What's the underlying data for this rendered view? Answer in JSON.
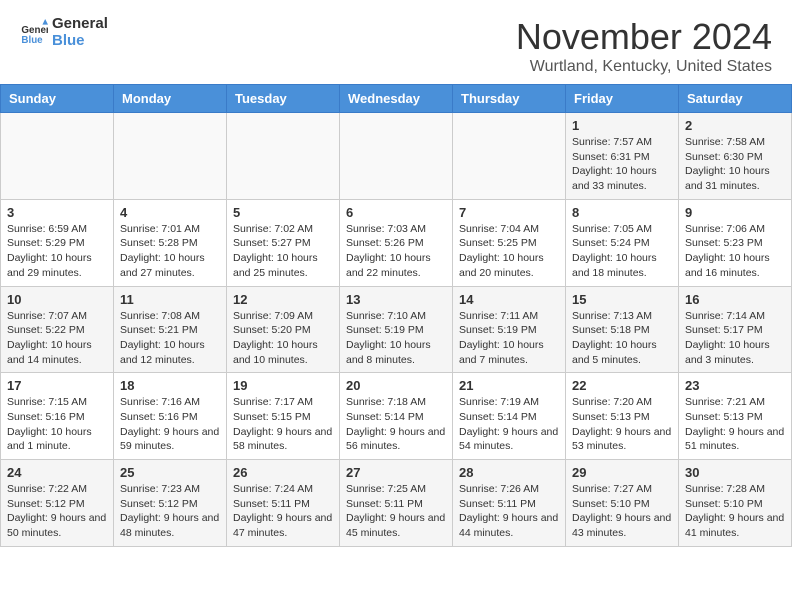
{
  "header": {
    "logo_line1": "General",
    "logo_line2": "Blue",
    "month": "November 2024",
    "location": "Wurtland, Kentucky, United States"
  },
  "weekdays": [
    "Sunday",
    "Monday",
    "Tuesday",
    "Wednesday",
    "Thursday",
    "Friday",
    "Saturday"
  ],
  "weeks": [
    [
      {
        "day": "",
        "info": ""
      },
      {
        "day": "",
        "info": ""
      },
      {
        "day": "",
        "info": ""
      },
      {
        "day": "",
        "info": ""
      },
      {
        "day": "",
        "info": ""
      },
      {
        "day": "1",
        "info": "Sunrise: 7:57 AM\nSunset: 6:31 PM\nDaylight: 10 hours and 33 minutes."
      },
      {
        "day": "2",
        "info": "Sunrise: 7:58 AM\nSunset: 6:30 PM\nDaylight: 10 hours and 31 minutes."
      }
    ],
    [
      {
        "day": "3",
        "info": "Sunrise: 6:59 AM\nSunset: 5:29 PM\nDaylight: 10 hours and 29 minutes."
      },
      {
        "day": "4",
        "info": "Sunrise: 7:01 AM\nSunset: 5:28 PM\nDaylight: 10 hours and 27 minutes."
      },
      {
        "day": "5",
        "info": "Sunrise: 7:02 AM\nSunset: 5:27 PM\nDaylight: 10 hours and 25 minutes."
      },
      {
        "day": "6",
        "info": "Sunrise: 7:03 AM\nSunset: 5:26 PM\nDaylight: 10 hours and 22 minutes."
      },
      {
        "day": "7",
        "info": "Sunrise: 7:04 AM\nSunset: 5:25 PM\nDaylight: 10 hours and 20 minutes."
      },
      {
        "day": "8",
        "info": "Sunrise: 7:05 AM\nSunset: 5:24 PM\nDaylight: 10 hours and 18 minutes."
      },
      {
        "day": "9",
        "info": "Sunrise: 7:06 AM\nSunset: 5:23 PM\nDaylight: 10 hours and 16 minutes."
      }
    ],
    [
      {
        "day": "10",
        "info": "Sunrise: 7:07 AM\nSunset: 5:22 PM\nDaylight: 10 hours and 14 minutes."
      },
      {
        "day": "11",
        "info": "Sunrise: 7:08 AM\nSunset: 5:21 PM\nDaylight: 10 hours and 12 minutes."
      },
      {
        "day": "12",
        "info": "Sunrise: 7:09 AM\nSunset: 5:20 PM\nDaylight: 10 hours and 10 minutes."
      },
      {
        "day": "13",
        "info": "Sunrise: 7:10 AM\nSunset: 5:19 PM\nDaylight: 10 hours and 8 minutes."
      },
      {
        "day": "14",
        "info": "Sunrise: 7:11 AM\nSunset: 5:19 PM\nDaylight: 10 hours and 7 minutes."
      },
      {
        "day": "15",
        "info": "Sunrise: 7:13 AM\nSunset: 5:18 PM\nDaylight: 10 hours and 5 minutes."
      },
      {
        "day": "16",
        "info": "Sunrise: 7:14 AM\nSunset: 5:17 PM\nDaylight: 10 hours and 3 minutes."
      }
    ],
    [
      {
        "day": "17",
        "info": "Sunrise: 7:15 AM\nSunset: 5:16 PM\nDaylight: 10 hours and 1 minute."
      },
      {
        "day": "18",
        "info": "Sunrise: 7:16 AM\nSunset: 5:16 PM\nDaylight: 9 hours and 59 minutes."
      },
      {
        "day": "19",
        "info": "Sunrise: 7:17 AM\nSunset: 5:15 PM\nDaylight: 9 hours and 58 minutes."
      },
      {
        "day": "20",
        "info": "Sunrise: 7:18 AM\nSunset: 5:14 PM\nDaylight: 9 hours and 56 minutes."
      },
      {
        "day": "21",
        "info": "Sunrise: 7:19 AM\nSunset: 5:14 PM\nDaylight: 9 hours and 54 minutes."
      },
      {
        "day": "22",
        "info": "Sunrise: 7:20 AM\nSunset: 5:13 PM\nDaylight: 9 hours and 53 minutes."
      },
      {
        "day": "23",
        "info": "Sunrise: 7:21 AM\nSunset: 5:13 PM\nDaylight: 9 hours and 51 minutes."
      }
    ],
    [
      {
        "day": "24",
        "info": "Sunrise: 7:22 AM\nSunset: 5:12 PM\nDaylight: 9 hours and 50 minutes."
      },
      {
        "day": "25",
        "info": "Sunrise: 7:23 AM\nSunset: 5:12 PM\nDaylight: 9 hours and 48 minutes."
      },
      {
        "day": "26",
        "info": "Sunrise: 7:24 AM\nSunset: 5:11 PM\nDaylight: 9 hours and 47 minutes."
      },
      {
        "day": "27",
        "info": "Sunrise: 7:25 AM\nSunset: 5:11 PM\nDaylight: 9 hours and 45 minutes."
      },
      {
        "day": "28",
        "info": "Sunrise: 7:26 AM\nSunset: 5:11 PM\nDaylight: 9 hours and 44 minutes."
      },
      {
        "day": "29",
        "info": "Sunrise: 7:27 AM\nSunset: 5:10 PM\nDaylight: 9 hours and 43 minutes."
      },
      {
        "day": "30",
        "info": "Sunrise: 7:28 AM\nSunset: 5:10 PM\nDaylight: 9 hours and 41 minutes."
      }
    ]
  ]
}
